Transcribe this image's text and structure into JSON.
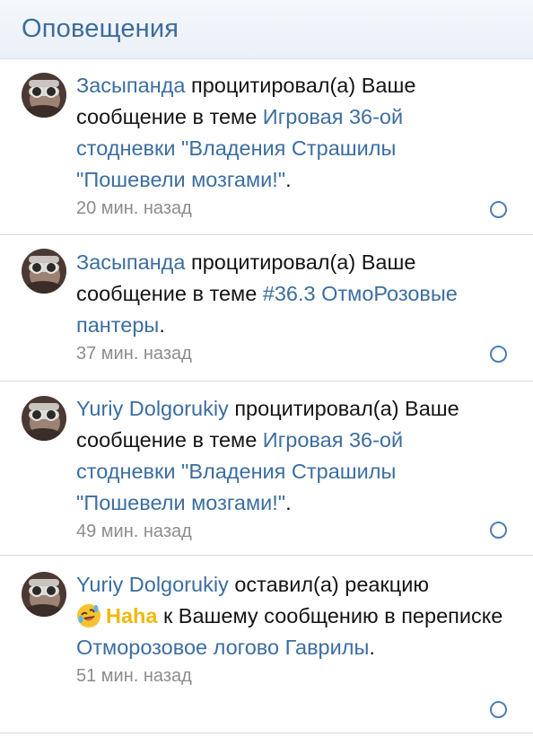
{
  "header": {
    "title": "Оповещения"
  },
  "notifications": [
    {
      "user": "Засыпанда",
      "action": "процитировал(а) Ваше сообщение в теме",
      "target": "Игровая 36-ой стодневки \"Владения Страшилы \"Пошевели мозгами!\"",
      "punct": ".",
      "time": "20 мин. назад"
    },
    {
      "user": "Засыпанда",
      "action": "процитировал(а) Ваше сообщение в теме",
      "target": "#36.3 ОтмоРозовые пантеры",
      "punct": ".",
      "time": "37 мин. назад"
    },
    {
      "user": "Yuriy Dolgorukiy",
      "action": "процитировал(а) Ваше сообщение в теме",
      "target": "Игровая 36-ой стодневки \"Владения Страшилы \"Пошевели мозгами!\"",
      "punct": ".",
      "time": "49 мин. назад"
    },
    {
      "user": "Yuriy Dolgorukiy",
      "action": "оставил(а) реакцию",
      "reaction_icon": "rolling-laughing-emoji-icon",
      "reaction": "Haha",
      "action2": "к Вашему сообщению в переписке",
      "target": "Отморозовое логово Гаврилы",
      "punct": ".",
      "time": "51 мин. назад"
    }
  ],
  "colors": {
    "link": "#3c6ea0",
    "header_title": "#3c6c9c",
    "reaction": "#f0b90b",
    "time": "#8c8c8c"
  }
}
